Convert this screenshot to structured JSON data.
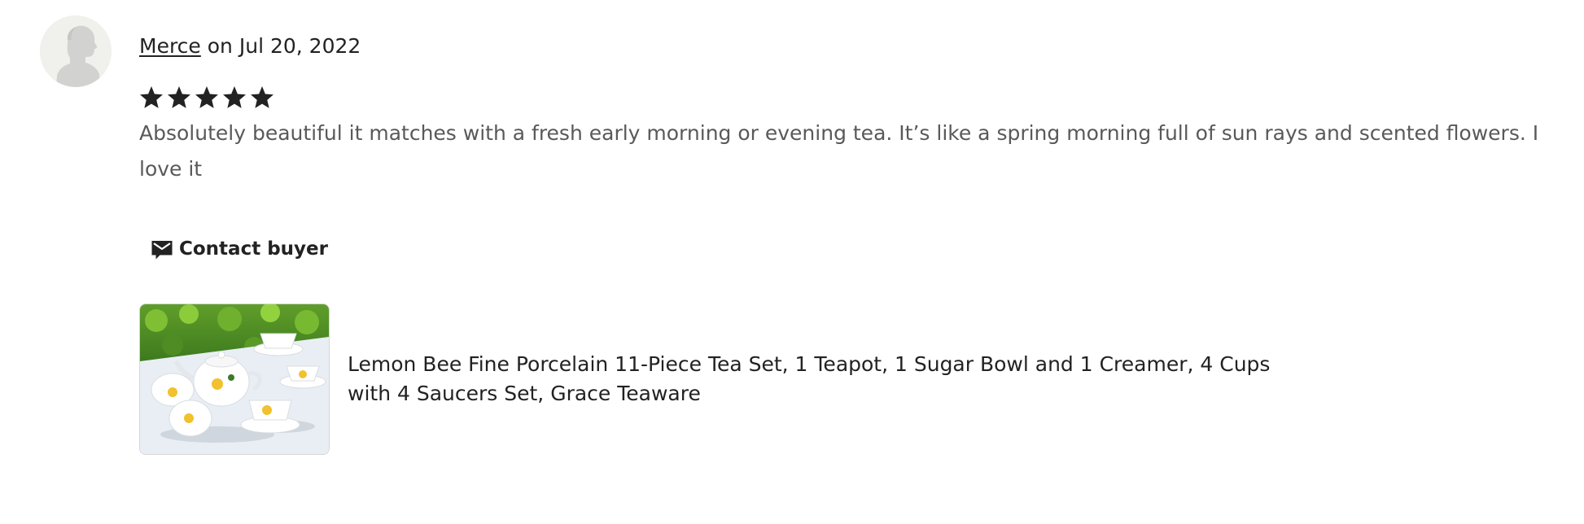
{
  "review": {
    "reviewer_name": "Merce",
    "date_prefix": " on ",
    "date": "Jul 20, 2022",
    "rating": 5,
    "rating_max": 5,
    "text": "Absolutely beautiful it matches with a fresh early morning or evening tea. It’s like a spring morning full of sun rays and scented flowers. I love it",
    "contact_label": "Contact buyer",
    "product_title": "Lemon Bee Fine Porcelain 11-Piece Tea Set, 1 Teapot, 1 Sugar Bowl and 1 Creamer, 4 Cups with 4 Saucers Set, Grace Teaware"
  },
  "icons": {
    "avatar": "default-avatar-icon",
    "star": "star-filled-icon",
    "contact": "envelope-chat-icon"
  },
  "colors": {
    "text_primary": "#222222",
    "text_secondary": "#595959",
    "star": "#222222",
    "avatar_bg": "#f0f0ec",
    "avatar_silhouette": "#d2d2d0"
  }
}
